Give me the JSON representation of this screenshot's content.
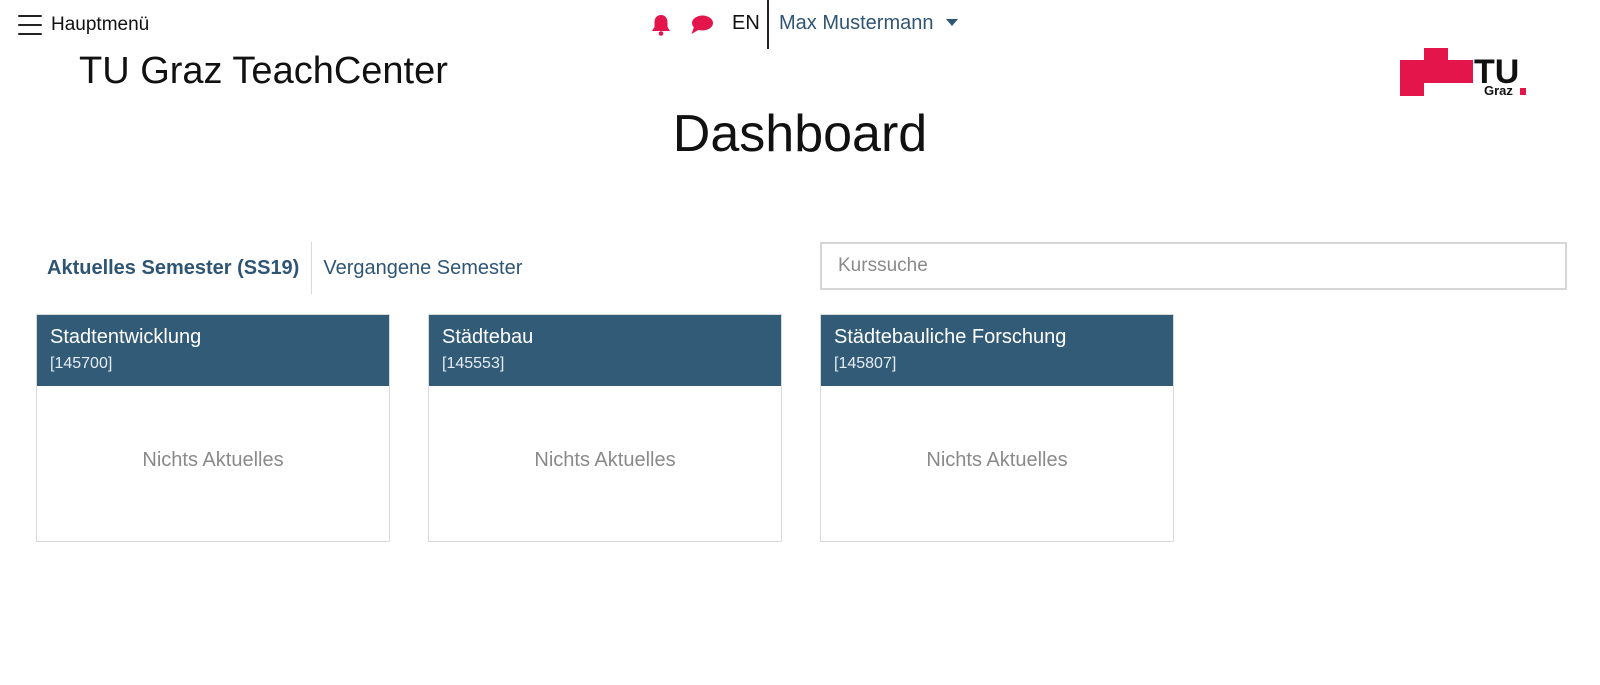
{
  "topbar": {
    "menu_label": "Hauptmenü",
    "language": "EN",
    "user_name": "Max Mustermann"
  },
  "brand": {
    "site_title": "TU Graz TeachCenter",
    "logo_text_main": "TU",
    "logo_text_sub": "Graz"
  },
  "page": {
    "title": "Dashboard"
  },
  "tabs": [
    {
      "label": "Aktuelles Semester (SS19)",
      "active": true
    },
    {
      "label": "Vergangene Semester",
      "active": false
    }
  ],
  "search": {
    "placeholder": "Kurssuche",
    "value": ""
  },
  "courses": [
    {
      "title": "Stadtentwicklung",
      "code": "[145700]",
      "status": "Nichts Aktuelles"
    },
    {
      "title": "Städtebau",
      "code": "[145553]",
      "status": "Nichts Aktuelles"
    },
    {
      "title": "Städtebauliche Forschung",
      "code": "[145807]",
      "status": "Nichts Aktuelles"
    }
  ],
  "colors": {
    "brand_red": "#e4154b",
    "primary_blue": "#325b78",
    "link_blue": "#2f5575"
  },
  "icons": {
    "menu": "hamburger-icon",
    "notifications": "bell-icon",
    "messages": "chat-bubble-icon",
    "dropdown": "caret-down-icon"
  }
}
